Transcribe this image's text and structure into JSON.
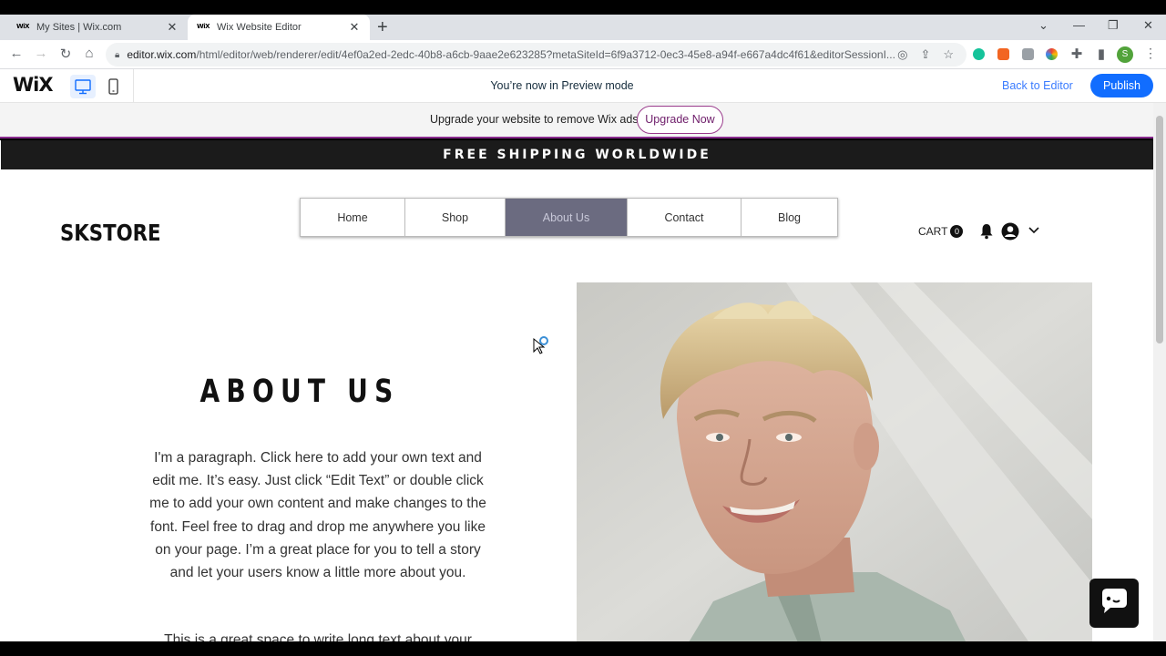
{
  "browser": {
    "tabs": [
      {
        "favicon": "WiX",
        "title": "My Sites | Wix.com"
      },
      {
        "favicon": "WiX",
        "title": "Wix Website Editor"
      }
    ],
    "url_host": "editor.wix.com",
    "url_path": "/html/editor/web/renderer/edit/4ef0a2ed-2edc-40b8-a6cb-9aae2e623285?metaSiteId=6f9a3712-0ec3-45e8-a94f-e667a4dc4f61&editorSessionI...",
    "profile_initial": "S"
  },
  "wix_bar": {
    "logo": "WiX",
    "preview_text": "You’re now in Preview mode",
    "back_to_editor": "Back to Editor",
    "publish": "Publish"
  },
  "upgrade_banner": {
    "text": "Upgrade your website to remove Wix ads",
    "button": "Upgrade Now"
  },
  "site": {
    "shipping_banner": "FREE SHIPPING WORLDWIDE",
    "brand": "SKSTORE",
    "nav": [
      {
        "label": "Home",
        "active": false
      },
      {
        "label": "Shop",
        "active": false
      },
      {
        "label": "About Us",
        "active": true
      },
      {
        "label": "Contact",
        "active": false
      },
      {
        "label": "Blog",
        "active": false
      }
    ],
    "cart_label": "CART",
    "cart_count": "0",
    "about_title": "ABOUT US",
    "about_paragraph": "I'm a paragraph. Click here to add your own text and edit me. It’s easy. Just click “Edit Text” or double click me to add your own content and make changes to the font. Feel free to drag and drop me anywhere you like on your page. I’m a great place for you to tell a story and let your users know a little more about you.",
    "about_paragraph2": "This is a great space to write long text about your"
  },
  "icons": [
    "back-icon",
    "forward-icon",
    "reload-icon",
    "home-icon",
    "lock-icon",
    "star-icon",
    "bell-icon",
    "user-icon",
    "chevron-down-icon",
    "chat-icon"
  ]
}
